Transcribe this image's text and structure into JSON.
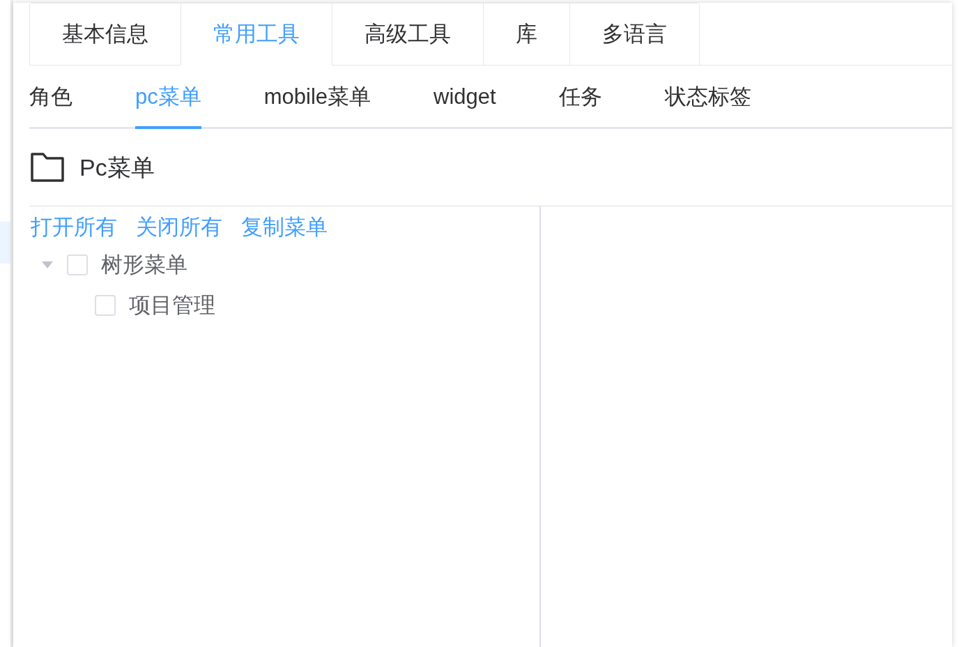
{
  "tabs": [
    {
      "label": "基本信息",
      "selected": false
    },
    {
      "label": "常用工具",
      "selected": true
    },
    {
      "label": "高级工具",
      "selected": false
    },
    {
      "label": "库",
      "selected": false
    },
    {
      "label": "多语言",
      "selected": false
    }
  ],
  "subtabs": [
    {
      "label": "角色",
      "selected": false
    },
    {
      "label": "pc菜单",
      "selected": true
    },
    {
      "label": "mobile菜单",
      "selected": false
    },
    {
      "label": "widget",
      "selected": false
    },
    {
      "label": "任务",
      "selected": false
    },
    {
      "label": "状态标签",
      "selected": false
    }
  ],
  "panel": {
    "title": "Pc菜单"
  },
  "actions": [
    "打开所有",
    "关闭所有",
    "复制菜单"
  ],
  "tree": [
    {
      "label": "树形菜单",
      "checked": false,
      "expanded": true,
      "children": [
        {
          "label": "项目管理",
          "checked": false
        }
      ]
    }
  ]
}
